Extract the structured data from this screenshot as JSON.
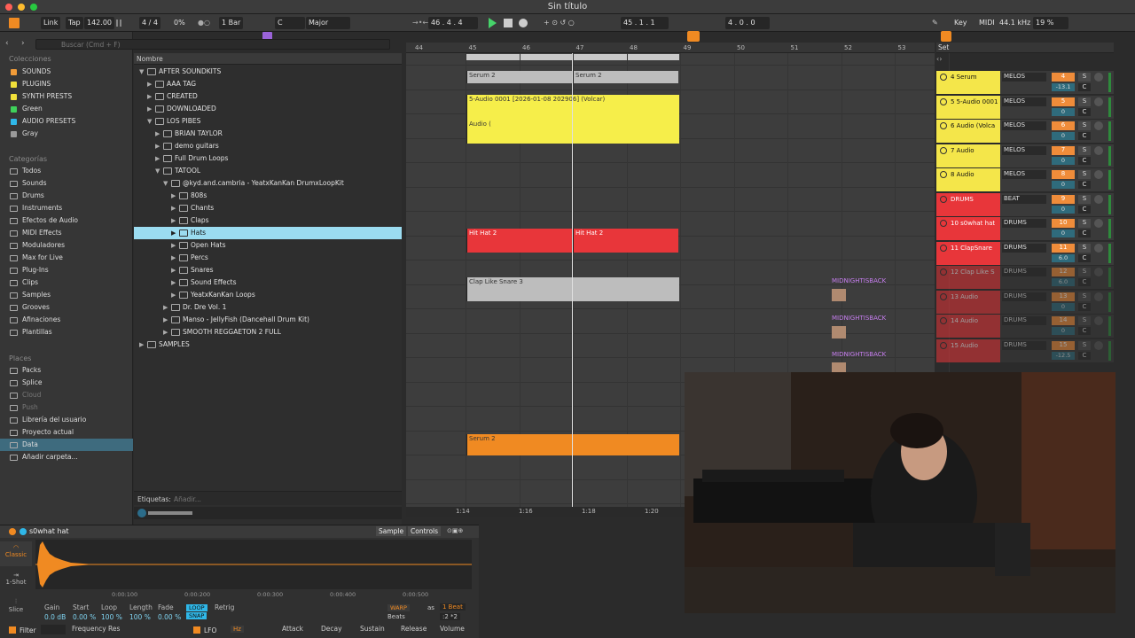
{
  "window": {
    "title": "Sin título"
  },
  "transport": {
    "link": "Link",
    "tap": "Tap",
    "tempo": "142.00",
    "signature": "4 / 4",
    "cpu_left": "0%",
    "quantize": "1 Bar",
    "key_root": "C",
    "scale": "Major",
    "position": "46 .  4 .  4",
    "loop_start": "45 .  1 .  1",
    "loop_length": "4 .  0 .  0",
    "key_label": "Key",
    "midi_label": "MIDI",
    "sample_rate": "44.1 kHz",
    "cpu": "19 %"
  },
  "search": {
    "placeholder": "Buscar (Cmd + F)"
  },
  "sidebar": {
    "collections_header": "Colecciones",
    "collections": [
      {
        "label": "SOUNDS",
        "color": "#f29c38"
      },
      {
        "label": "PLUGINS",
        "color": "#f2e13a"
      },
      {
        "label": "SYNTH PRESTS",
        "color": "#f2e13a"
      },
      {
        "label": "Green",
        "color": "#3fd15a"
      },
      {
        "label": "AUDIO PRESETS",
        "color": "#2fb7e8"
      },
      {
        "label": "Gray",
        "color": "#9a9a9a"
      }
    ],
    "categories_header": "Categorías",
    "categories": [
      "Todos",
      "Sounds",
      "Drums",
      "Instruments",
      "Efectos de Audio",
      "MIDI Effects",
      "Moduladores",
      "Max for Live",
      "Plug-Ins",
      "Clips",
      "Samples",
      "Grooves",
      "Afinaciones",
      "Plantillas"
    ],
    "places_header": "Places",
    "places": [
      "Packs",
      "Splice",
      "Cloud",
      "Push",
      "Librería del usuario",
      "Proyecto actual",
      "Data",
      "Añadir carpeta..."
    ]
  },
  "browser": {
    "column_header": "Nombre",
    "rows": [
      {
        "label": "AFTER SOUNDKITS",
        "depth": 0,
        "open": true
      },
      {
        "label": "AAA TAG",
        "depth": 1,
        "open": false
      },
      {
        "label": "CREATED",
        "depth": 1,
        "open": false
      },
      {
        "label": "DOWNLOADED",
        "depth": 1,
        "open": false
      },
      {
        "label": "LOS PIBES",
        "depth": 1,
        "open": true
      },
      {
        "label": "BRIAN TAYLOR",
        "depth": 2,
        "open": false
      },
      {
        "label": "demo guitars",
        "depth": 2,
        "open": false
      },
      {
        "label": "Full Drum Loops",
        "depth": 2,
        "open": false
      },
      {
        "label": "TATOOL",
        "depth": 2,
        "open": true
      },
      {
        "label": "@kyd.and.cambria - YeatxKanKan DrumxLoopKit",
        "depth": 3,
        "open": true
      },
      {
        "label": "808s",
        "depth": 4,
        "open": false
      },
      {
        "label": "Chants",
        "depth": 4,
        "open": false
      },
      {
        "label": "Claps",
        "depth": 4,
        "open": false
      },
      {
        "label": "Hats",
        "depth": 4,
        "open": false,
        "selected": true
      },
      {
        "label": "Open Hats",
        "depth": 4,
        "open": false
      },
      {
        "label": "Percs",
        "depth": 4,
        "open": false
      },
      {
        "label": "Snares",
        "depth": 4,
        "open": false
      },
      {
        "label": "Sound Effects",
        "depth": 4,
        "open": false
      },
      {
        "label": "YeatxKanKan Loops",
        "depth": 4,
        "open": false
      },
      {
        "label": "Dr. Dre Vol. 1",
        "depth": 3,
        "open": false
      },
      {
        "label": "Manso - JellyFish (Dancehall Drum Kit)",
        "depth": 3,
        "open": false
      },
      {
        "label": "SMOOTH REGGAETON 2 FULL",
        "depth": 3,
        "open": false
      },
      {
        "label": "SAMPLES",
        "depth": 0,
        "open": false
      }
    ],
    "tags_label": "Etiquetas:",
    "tags_placeholder": "Añadir..."
  },
  "arrangement": {
    "bars": [
      "44",
      "45",
      "46",
      "47",
      "48",
      "49",
      "50",
      "51",
      "52",
      "53"
    ],
    "time_marks": [
      "1:14",
      "1:16",
      "1:18",
      "1:20"
    ],
    "set_label": "Set",
    "clips": [
      {
        "label": "Serum 2",
        "lane": 0,
        "color": "#bdbdbd"
      },
      {
        "label": "Serum 2",
        "lane": 0,
        "color": "#bdbdbd"
      },
      {
        "label": "5-Audio 0001 [2026-01-08 202906] (Volcar)",
        "lane": 1,
        "color": "#f6ee4a"
      },
      {
        "label": "Audio (",
        "lane": 2,
        "color": "#f6ee4a"
      },
      {
        "label": "Hit Hat 2",
        "lane": 6,
        "color": "#e8363a"
      },
      {
        "label": "Hit Hat 2",
        "lane": 6,
        "color": "#e8363a"
      },
      {
        "label": "Clap Like Snare 3",
        "lane": 7,
        "color": "#bdbdbd"
      },
      {
        "label": "Serum 2",
        "lane": 15,
        "color": "#f08a22"
      }
    ],
    "session_clips": [
      "MIDNIGHTISBACK",
      "MIDNIGHTISBACK",
      "MIDNIGHTISBACK"
    ]
  },
  "tracks": [
    {
      "name": "4 Serum",
      "group": "MELOS",
      "num": "4",
      "vol": "-13.1",
      "color": "#f4e64a",
      "pan": "C"
    },
    {
      "name": "5 5-Audio 0001",
      "group": "MELOS",
      "num": "5",
      "vol": "0",
      "color": "#f4e64a",
      "pan": "C"
    },
    {
      "name": "6 Audio (Volca",
      "group": "MELOS",
      "num": "6",
      "vol": "0",
      "color": "#f4e64a",
      "pan": "C"
    },
    {
      "name": "7 Audio",
      "group": "MELOS",
      "num": "7",
      "vol": "0",
      "color": "#f4e64a",
      "pan": "C"
    },
    {
      "name": "8 Audio",
      "group": "MELOS",
      "num": "8",
      "vol": "0",
      "color": "#f4e64a",
      "pan": "C"
    },
    {
      "name": "DRUMS",
      "group": "BEAT",
      "num": "9",
      "vol": "0",
      "color": "#e8363a",
      "pan": "C"
    },
    {
      "name": "10 s0what hat",
      "group": "DRUMS",
      "num": "10",
      "vol": "0",
      "color": "#e8363a",
      "pan": "C"
    },
    {
      "name": "11 ClapSnare",
      "group": "DRUMS",
      "num": "11",
      "vol": "6.0",
      "color": "#e8363a",
      "pan": "C"
    },
    {
      "name": "12 Clap Like S",
      "group": "DRUMS",
      "num": "12",
      "vol": "6.0",
      "color": "#e8363a",
      "pan": "C"
    },
    {
      "name": "13 Audio",
      "group": "DRUMS",
      "num": "13",
      "vol": "0",
      "color": "#e8363a",
      "pan": "C"
    },
    {
      "name": "14 Audio",
      "group": "DRUMS",
      "num": "14",
      "vol": "0",
      "color": "#e8363a",
      "pan": "C"
    },
    {
      "name": "15 Audio",
      "group": "DRUMS",
      "num": "15",
      "vol": "-12.5",
      "color": "#e8363a",
      "pan": "C"
    }
  ],
  "device": {
    "title": "s0what hat",
    "tab_sample": "Sample",
    "tab_controls": "Controls",
    "mode_classic": "Classic",
    "mode_oneshot": "1-Shot",
    "mode_slice": "Slice",
    "timeline": [
      "0:00:100",
      "0:00:200",
      "0:00:300",
      "0:00:400",
      "0:00:500"
    ],
    "params": [
      {
        "label": "Gain",
        "value": "0.0 dB"
      },
      {
        "label": "Start",
        "value": "0.00 %"
      },
      {
        "label": "Loop",
        "value": "100 %"
      },
      {
        "label": "Length",
        "value": "100 %"
      },
      {
        "label": "Fade",
        "value": "0.00 %"
      },
      {
        "label": "Voices",
        "value": "6"
      },
      {
        "label": "Retrig",
        "value": ""
      }
    ],
    "loop_btn": "LOOP",
    "snap_btn": "SNAP",
    "warp_btn": "WARP",
    "as_label": "as",
    "beat_value": "1 Beat",
    "beats_label": "Beats",
    "filter_label": "Filter",
    "frequency_label": "Frequency",
    "res_label": "Res",
    "lfo_label": "LFO",
    "hz_label": "Hz",
    "attack_label": "Attack",
    "decay_label": "Decay",
    "sustain_label": "Sustain",
    "release_label": "Release",
    "volume_label": "Volume"
  }
}
